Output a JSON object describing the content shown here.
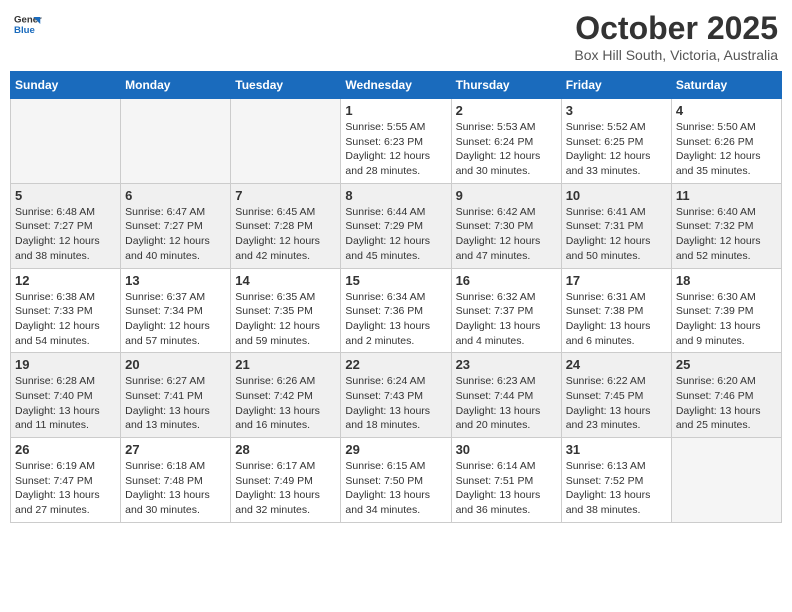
{
  "logo": {
    "line1": "General",
    "line2": "Blue"
  },
  "title": "October 2025",
  "subtitle": "Box Hill South, Victoria, Australia",
  "weekdays": [
    "Sunday",
    "Monday",
    "Tuesday",
    "Wednesday",
    "Thursday",
    "Friday",
    "Saturday"
  ],
  "weeks": [
    [
      {
        "day": "",
        "info": ""
      },
      {
        "day": "",
        "info": ""
      },
      {
        "day": "",
        "info": ""
      },
      {
        "day": "1",
        "info": "Sunrise: 5:55 AM\nSunset: 6:23 PM\nDaylight: 12 hours\nand 28 minutes."
      },
      {
        "day": "2",
        "info": "Sunrise: 5:53 AM\nSunset: 6:24 PM\nDaylight: 12 hours\nand 30 minutes."
      },
      {
        "day": "3",
        "info": "Sunrise: 5:52 AM\nSunset: 6:25 PM\nDaylight: 12 hours\nand 33 minutes."
      },
      {
        "day": "4",
        "info": "Sunrise: 5:50 AM\nSunset: 6:26 PM\nDaylight: 12 hours\nand 35 minutes."
      }
    ],
    [
      {
        "day": "5",
        "info": "Sunrise: 6:48 AM\nSunset: 7:27 PM\nDaylight: 12 hours\nand 38 minutes."
      },
      {
        "day": "6",
        "info": "Sunrise: 6:47 AM\nSunset: 7:27 PM\nDaylight: 12 hours\nand 40 minutes."
      },
      {
        "day": "7",
        "info": "Sunrise: 6:45 AM\nSunset: 7:28 PM\nDaylight: 12 hours\nand 42 minutes."
      },
      {
        "day": "8",
        "info": "Sunrise: 6:44 AM\nSunset: 7:29 PM\nDaylight: 12 hours\nand 45 minutes."
      },
      {
        "day": "9",
        "info": "Sunrise: 6:42 AM\nSunset: 7:30 PM\nDaylight: 12 hours\nand 47 minutes."
      },
      {
        "day": "10",
        "info": "Sunrise: 6:41 AM\nSunset: 7:31 PM\nDaylight: 12 hours\nand 50 minutes."
      },
      {
        "day": "11",
        "info": "Sunrise: 6:40 AM\nSunset: 7:32 PM\nDaylight: 12 hours\nand 52 minutes."
      }
    ],
    [
      {
        "day": "12",
        "info": "Sunrise: 6:38 AM\nSunset: 7:33 PM\nDaylight: 12 hours\nand 54 minutes."
      },
      {
        "day": "13",
        "info": "Sunrise: 6:37 AM\nSunset: 7:34 PM\nDaylight: 12 hours\nand 57 minutes."
      },
      {
        "day": "14",
        "info": "Sunrise: 6:35 AM\nSunset: 7:35 PM\nDaylight: 12 hours\nand 59 minutes."
      },
      {
        "day": "15",
        "info": "Sunrise: 6:34 AM\nSunset: 7:36 PM\nDaylight: 13 hours\nand 2 minutes."
      },
      {
        "day": "16",
        "info": "Sunrise: 6:32 AM\nSunset: 7:37 PM\nDaylight: 13 hours\nand 4 minutes."
      },
      {
        "day": "17",
        "info": "Sunrise: 6:31 AM\nSunset: 7:38 PM\nDaylight: 13 hours\nand 6 minutes."
      },
      {
        "day": "18",
        "info": "Sunrise: 6:30 AM\nSunset: 7:39 PM\nDaylight: 13 hours\nand 9 minutes."
      }
    ],
    [
      {
        "day": "19",
        "info": "Sunrise: 6:28 AM\nSunset: 7:40 PM\nDaylight: 13 hours\nand 11 minutes."
      },
      {
        "day": "20",
        "info": "Sunrise: 6:27 AM\nSunset: 7:41 PM\nDaylight: 13 hours\nand 13 minutes."
      },
      {
        "day": "21",
        "info": "Sunrise: 6:26 AM\nSunset: 7:42 PM\nDaylight: 13 hours\nand 16 minutes."
      },
      {
        "day": "22",
        "info": "Sunrise: 6:24 AM\nSunset: 7:43 PM\nDaylight: 13 hours\nand 18 minutes."
      },
      {
        "day": "23",
        "info": "Sunrise: 6:23 AM\nSunset: 7:44 PM\nDaylight: 13 hours\nand 20 minutes."
      },
      {
        "day": "24",
        "info": "Sunrise: 6:22 AM\nSunset: 7:45 PM\nDaylight: 13 hours\nand 23 minutes."
      },
      {
        "day": "25",
        "info": "Sunrise: 6:20 AM\nSunset: 7:46 PM\nDaylight: 13 hours\nand 25 minutes."
      }
    ],
    [
      {
        "day": "26",
        "info": "Sunrise: 6:19 AM\nSunset: 7:47 PM\nDaylight: 13 hours\nand 27 minutes."
      },
      {
        "day": "27",
        "info": "Sunrise: 6:18 AM\nSunset: 7:48 PM\nDaylight: 13 hours\nand 30 minutes."
      },
      {
        "day": "28",
        "info": "Sunrise: 6:17 AM\nSunset: 7:49 PM\nDaylight: 13 hours\nand 32 minutes."
      },
      {
        "day": "29",
        "info": "Sunrise: 6:15 AM\nSunset: 7:50 PM\nDaylight: 13 hours\nand 34 minutes."
      },
      {
        "day": "30",
        "info": "Sunrise: 6:14 AM\nSunset: 7:51 PM\nDaylight: 13 hours\nand 36 minutes."
      },
      {
        "day": "31",
        "info": "Sunrise: 6:13 AM\nSunset: 7:52 PM\nDaylight: 13 hours\nand 38 minutes."
      },
      {
        "day": "",
        "info": ""
      }
    ]
  ]
}
